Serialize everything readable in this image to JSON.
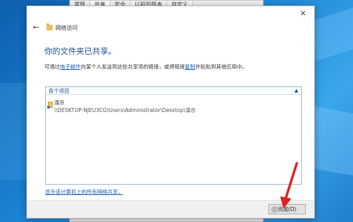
{
  "background_window": {
    "tabs": [
      "常规",
      "共享",
      "安全",
      "以前的版本",
      "自定义"
    ]
  },
  "dialog": {
    "close_glyph": "✕",
    "back_glyph": "←",
    "window_title": "网络访问",
    "heading": "你的文件夹已共享。",
    "description": {
      "part1": "可通过",
      "email_link": "电子邮件",
      "part2": "向某个人发送到这些共享项的链接，或将链接",
      "copy_link": "复制",
      "part3": "并粘贴到其他应用中。"
    },
    "list": {
      "header": "各个项目",
      "collapse_glyph": "▲",
      "items": [
        {
          "name": "演示",
          "path": "\\\\DESKTOP-NJEU3CG\\Users\\Administrator\\Desktop\\演示"
        }
      ]
    },
    "show_all_link": "显示该计算机上的所有网络共享。",
    "done_button": "完成(D)"
  },
  "colors": {
    "heading": "#1a4f8f",
    "link": "#1a5fb4",
    "annotation_arrow": "#e02020"
  },
  "icons": [
    "close-icon",
    "back-arrow-icon",
    "folder-icon",
    "shared-folder-icon",
    "collapse-chevron-icon",
    "red-arrow-annotation"
  ]
}
